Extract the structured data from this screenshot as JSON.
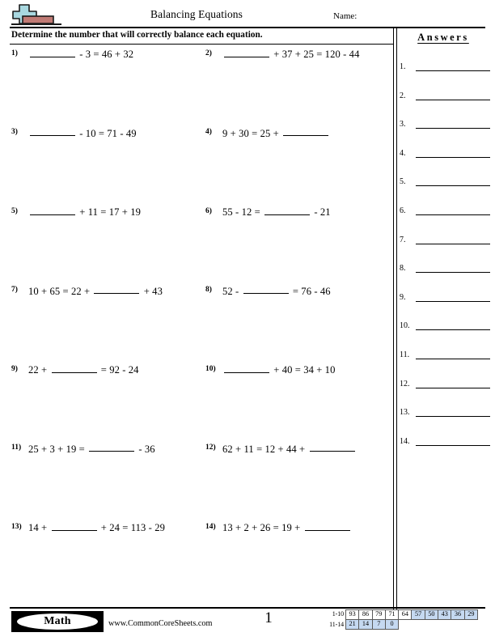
{
  "header": {
    "title": "Balancing Equations",
    "name_label": "Name:",
    "logo_icon": "plus-block-balance-icon",
    "logo_plus_color": "#a8d8e0",
    "logo_block_color": "#c07a74"
  },
  "instruction": "Determine the number that will correctly balance each equation.",
  "answers": {
    "title": "Answers",
    "rows": [
      {
        "num": "1."
      },
      {
        "num": "2."
      },
      {
        "num": "3."
      },
      {
        "num": "4."
      },
      {
        "num": "5."
      },
      {
        "num": "6."
      },
      {
        "num": "7."
      },
      {
        "num": "8."
      },
      {
        "num": "9."
      },
      {
        "num": "10."
      },
      {
        "num": "11."
      },
      {
        "num": "12."
      },
      {
        "num": "13."
      },
      {
        "num": "14."
      }
    ]
  },
  "problems": [
    {
      "num": "1)",
      "pre": "",
      "post": " - 3 = 46 + 32",
      "blank_first": true
    },
    {
      "num": "2)",
      "pre": "",
      "post": " + 37 + 25 = 120 - 44",
      "blank_first": true
    },
    {
      "num": "3)",
      "pre": "",
      "post": " - 10 = 71 - 49",
      "blank_first": true
    },
    {
      "num": "4)",
      "pre": "9 + 30 = 25 + ",
      "post": "",
      "blank_first": false
    },
    {
      "num": "5)",
      "pre": "",
      "post": " + 11 = 17 + 19",
      "blank_first": true
    },
    {
      "num": "6)",
      "pre": "55 - 12 = ",
      "post": " - 21",
      "blank_first": false
    },
    {
      "num": "7)",
      "pre": "10 + 65 = 22 + ",
      "post": " + 43",
      "blank_first": false
    },
    {
      "num": "8)",
      "pre": "52 - ",
      "post": " = 76 - 46",
      "blank_first": false
    },
    {
      "num": "9)",
      "pre": "22 + ",
      "post": " = 92 - 24",
      "blank_first": false
    },
    {
      "num": "10)",
      "pre": "",
      "post": " + 40 = 34 + 10",
      "blank_first": true
    },
    {
      "num": "11)",
      "pre": "25 + 3 + 19 = ",
      "post": " - 36",
      "blank_first": false
    },
    {
      "num": "12)",
      "pre": "62 + 11 = 12 + 44 + ",
      "post": "",
      "blank_first": false
    },
    {
      "num": "13)",
      "pre": "14 + ",
      "post": " + 24 = 113 - 29",
      "blank_first": false
    },
    {
      "num": "14)",
      "pre": "13 + 2 + 26 = 19 + ",
      "post": "",
      "blank_first": false
    }
  ],
  "footer": {
    "brand": "Math",
    "url": "www.CommonCoreSheets.com",
    "page_number": "1",
    "score_table": {
      "highlight_color": "#c5d9f1",
      "rows": [
        {
          "label": "1-10",
          "cells": [
            {
              "value": "93",
              "highlight": false
            },
            {
              "value": "86",
              "highlight": false
            },
            {
              "value": "79",
              "highlight": false
            },
            {
              "value": "71",
              "highlight": false
            },
            {
              "value": "64",
              "highlight": false
            },
            {
              "value": "57",
              "highlight": true
            },
            {
              "value": "50",
              "highlight": true
            },
            {
              "value": "43",
              "highlight": true
            },
            {
              "value": "36",
              "highlight": true
            },
            {
              "value": "29",
              "highlight": true
            }
          ]
        },
        {
          "label": "11-14",
          "cells": [
            {
              "value": "21",
              "highlight": true
            },
            {
              "value": "14",
              "highlight": true
            },
            {
              "value": "7",
              "highlight": true
            },
            {
              "value": "0",
              "highlight": true
            }
          ]
        }
      ]
    }
  }
}
